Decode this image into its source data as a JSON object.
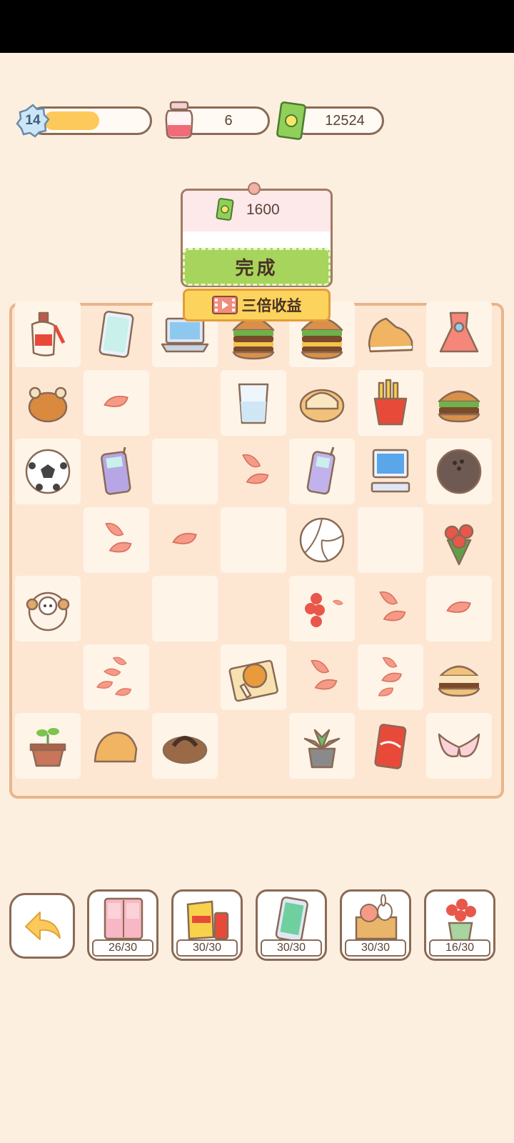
{
  "hud": {
    "level": "14",
    "level_progress": 0.6,
    "energy": "6",
    "cash": "12524"
  },
  "popup": {
    "reward": "1600",
    "done_label": "完成",
    "triple_label": "三倍收益"
  },
  "board": {
    "rows": [
      [
        "perfume",
        "smartphone",
        "laptop",
        "double-burger",
        "double-burger",
        "sneaker",
        "dress"
      ],
      [
        "roast-chicken",
        "petal",
        "empty",
        "glass",
        "slipper",
        "fries",
        "burger"
      ],
      [
        "soccer-ball",
        "old-phone",
        "empty",
        "petals-2",
        "flip-phone",
        "desktop-computer",
        "bowling-ball"
      ],
      [
        "empty",
        "petals-2",
        "petal",
        "empty",
        "volleyball",
        "empty",
        "rose-bouquet"
      ],
      [
        "plush-sheep",
        "empty",
        "empty",
        "empty",
        "rose-cluster",
        "petals-2",
        "petal"
      ],
      [
        "empty",
        "petals-4",
        "empty",
        "fried-chicken",
        "petals-2",
        "petals-3",
        "sandwich"
      ],
      [
        "sprout-pot",
        "clog",
        "wooden-sandal",
        "empty",
        "succulent-pot",
        "cola-can",
        "bra"
      ]
    ]
  },
  "collections": [
    {
      "icon": "wardrobe-icon",
      "count": "26/30"
    },
    {
      "icon": "snacks-icon",
      "count": "30/30"
    },
    {
      "icon": "phone-icon",
      "count": "30/30"
    },
    {
      "icon": "toy-box-icon",
      "count": "30/30"
    },
    {
      "icon": "flower-pot-icon",
      "count": "16/30"
    }
  ],
  "colors": {
    "background": "#fdefe0",
    "board_border": "#e9b58a",
    "done_button": "#a7d45c",
    "triple_button": "#fcd35c",
    "progress_fill": "#fcc95a"
  }
}
